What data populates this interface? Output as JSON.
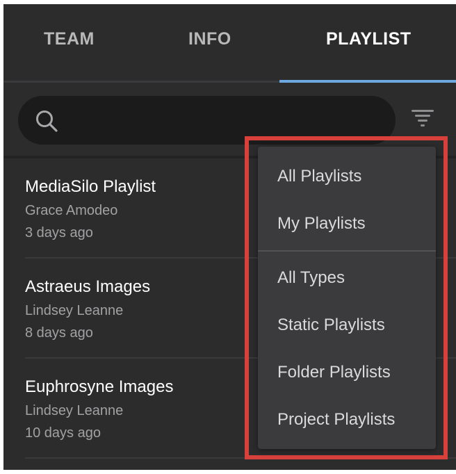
{
  "tabs": [
    {
      "label": "TEAM",
      "active": false
    },
    {
      "label": "INFO",
      "active": false
    },
    {
      "label": "PLAYLIST",
      "active": true
    }
  ],
  "search": {
    "placeholder": "",
    "value": ""
  },
  "icons": {
    "search": "search-icon",
    "filter": "filter-icon"
  },
  "playlists": [
    {
      "title": "MediaSilo Playlist",
      "owner": "Grace Amodeo",
      "updated": "3 days ago"
    },
    {
      "title": "Astraeus Images",
      "owner": "Lindsey Leanne",
      "updated": "8 days ago"
    },
    {
      "title": "Euphrosyne Images",
      "owner": "Lindsey Leanne",
      "updated": "10 days ago"
    }
  ],
  "filter_menu": {
    "ownership": [
      "All Playlists",
      "My Playlists"
    ],
    "types": [
      "All Types",
      "Static Playlists",
      "Folder Playlists",
      "Project Playlists"
    ]
  },
  "colors": {
    "background": "#2c2c2d",
    "active_tab_underline": "#6ca7e0",
    "highlight_border": "#d8403c"
  }
}
